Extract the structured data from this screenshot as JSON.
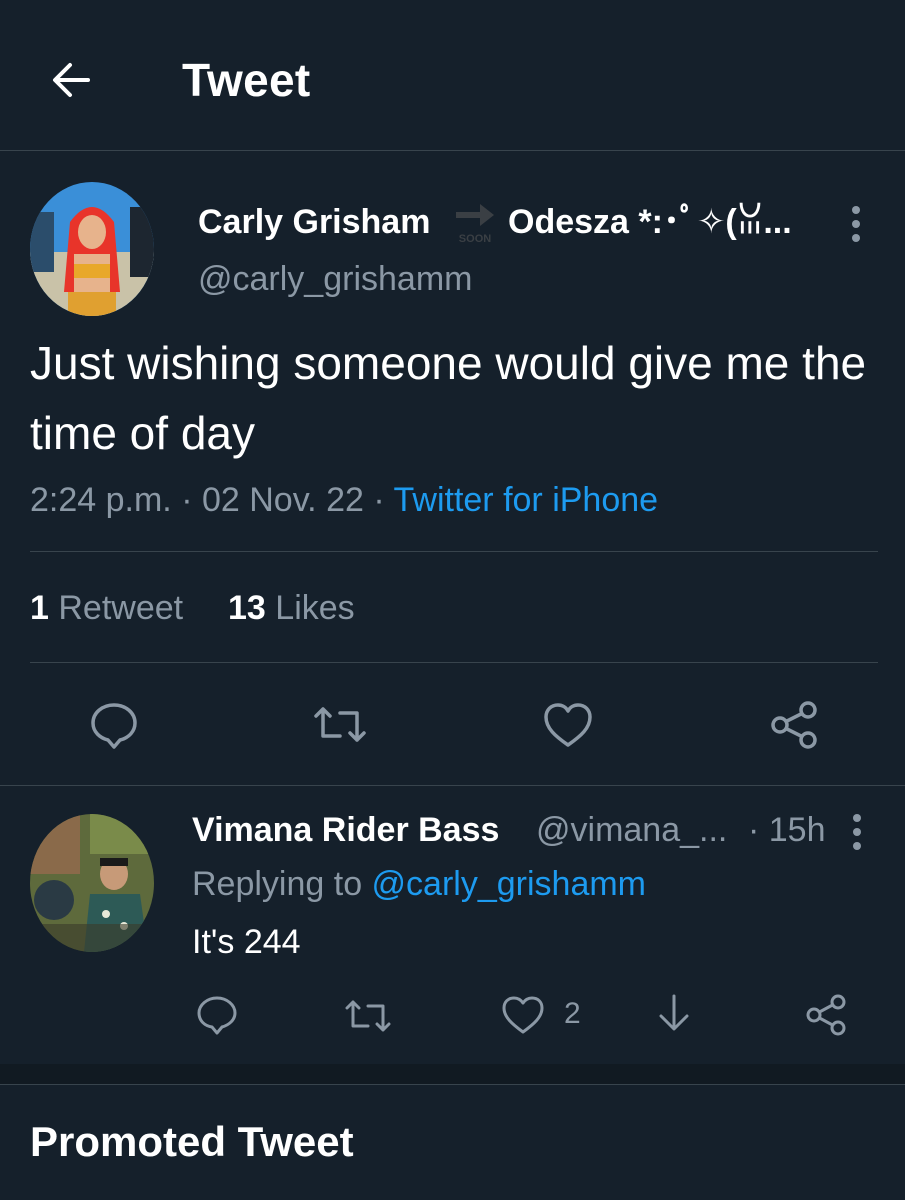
{
  "header": {
    "title": "Tweet"
  },
  "tweet": {
    "author_name": "Carly Grisham",
    "author_name_suffix": "Odesza *:･ﾟ✧(ꈍ...",
    "soon_badge": "SOON",
    "handle": "@carly_grishamm",
    "text": "Just wishing someone would give me the time of day",
    "time": "2:24 p.m.",
    "separator": " · ",
    "date": "02 Nov. 22",
    "source": "Twitter for iPhone",
    "retweet_count": "1",
    "retweet_label": " Retweet",
    "like_count": "13",
    "like_label": " Likes"
  },
  "reply": {
    "author_name": "Vimana Rider Bass",
    "handle": "@vimana_...",
    "time": "· 15h",
    "replying_prefix": "Replying to ",
    "replying_handle": "@carly_grishamm",
    "text": "It's 244",
    "like_count": "2"
  },
  "promoted": {
    "title": "Promoted Tweet"
  },
  "colors": {
    "background": "#15202b",
    "text": "#ffffff",
    "secondary": "#8b98a5",
    "accent": "#1d9bf0",
    "divider": "#38444d"
  },
  "icons": {
    "back": "back-arrow-icon",
    "more": "more-vertical-icon",
    "reply": "reply-bubble-icon",
    "retweet": "retweet-icon",
    "like": "heart-icon",
    "share": "share-icon",
    "downvote": "down-arrow-icon"
  }
}
